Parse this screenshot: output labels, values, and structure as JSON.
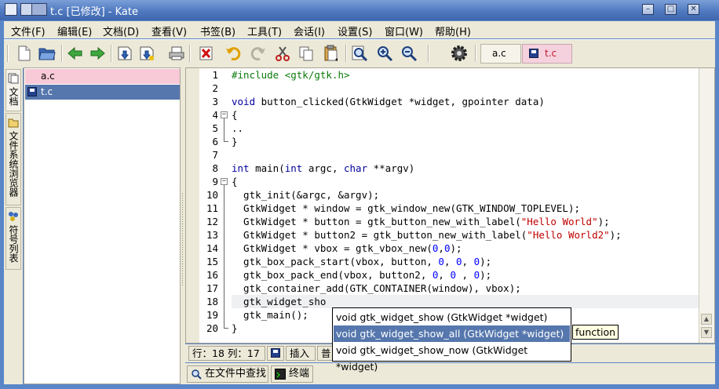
{
  "window": {
    "title": "t.c [已修改] - Kate"
  },
  "menu": [
    "文件(F)",
    "编辑(E)",
    "文档(D)",
    "查看(V)",
    "书签(B)",
    "工具(T)",
    "会话(I)",
    "设置(S)",
    "窗口(W)",
    "帮助(H)"
  ],
  "toolbar": {
    "icons": [
      "new-file-icon",
      "open-file-icon",
      "back-icon",
      "forward-icon",
      "save-icon",
      "save-as-icon",
      "print-icon",
      "close-icon",
      "undo-icon",
      "redo-icon",
      "cut-icon",
      "copy-icon",
      "paste-icon",
      "find-icon",
      "zoom-in-icon",
      "zoom-out-icon",
      "settings-gear-icon"
    ],
    "tabs": [
      {
        "label": "a.c",
        "modified": false
      },
      {
        "label": "t.c",
        "modified": true
      }
    ]
  },
  "sidebar": {
    "tabs": [
      "文档",
      "文件系统浏览器",
      "符号列表"
    ],
    "documents": [
      {
        "name": "a.c",
        "modified": false
      },
      {
        "name": "t.c",
        "modified": true
      }
    ]
  },
  "editor": {
    "line_numbers": [
      "1",
      "2",
      "3",
      "4",
      "5",
      "6",
      "7",
      "8",
      "9",
      "10",
      "11",
      "12",
      "13",
      "14",
      "15",
      "16",
      "17",
      "18",
      "19",
      "20"
    ],
    "current_line": 18
  },
  "completion": {
    "items": [
      "void gtk_widget_show (GtkWidget *widget)",
      "void gtk_widget_show_all (GtkWidget *widget)",
      "void gtk_widget_show_now (GtkWidget *widget)"
    ],
    "selected_index": 1,
    "tooltip": "function"
  },
  "status": {
    "position": "行：18 列：17",
    "mode": "插入",
    "mode2": "普"
  },
  "bottom_tabs": [
    "在文件中查找",
    "终端"
  ],
  "colors": {
    "titlebar": "#4f79c0",
    "selection": "#5677ad",
    "keyword": "#0000a0",
    "string": "#c00000",
    "number": "#0000ff"
  }
}
